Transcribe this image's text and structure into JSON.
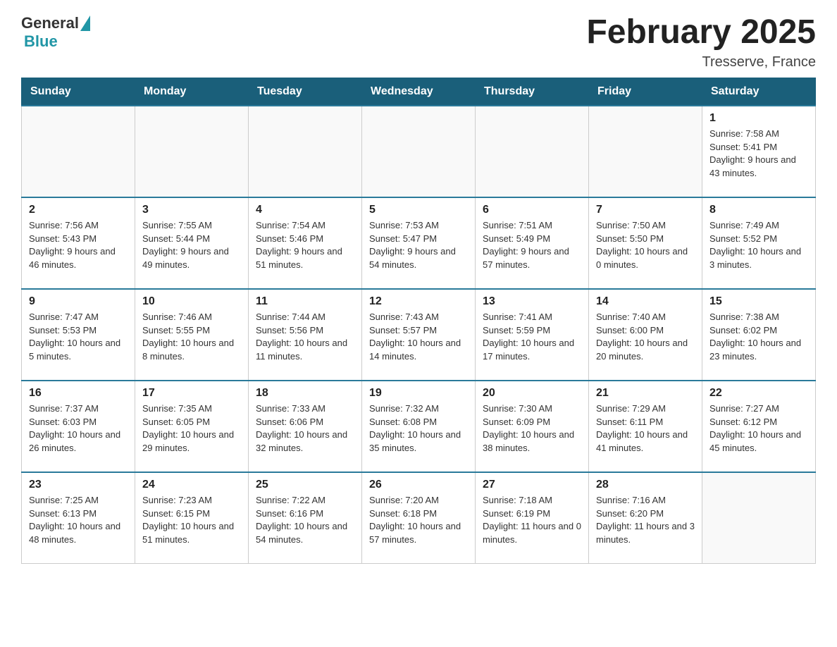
{
  "header": {
    "logo": {
      "general": "General",
      "blue": "Blue"
    },
    "title": "February 2025",
    "subtitle": "Tresserve, France"
  },
  "weekdays": [
    "Sunday",
    "Monday",
    "Tuesday",
    "Wednesday",
    "Thursday",
    "Friday",
    "Saturday"
  ],
  "weeks": [
    [
      {
        "day": "",
        "info": ""
      },
      {
        "day": "",
        "info": ""
      },
      {
        "day": "",
        "info": ""
      },
      {
        "day": "",
        "info": ""
      },
      {
        "day": "",
        "info": ""
      },
      {
        "day": "",
        "info": ""
      },
      {
        "day": "1",
        "info": "Sunrise: 7:58 AM\nSunset: 5:41 PM\nDaylight: 9 hours and 43 minutes."
      }
    ],
    [
      {
        "day": "2",
        "info": "Sunrise: 7:56 AM\nSunset: 5:43 PM\nDaylight: 9 hours and 46 minutes."
      },
      {
        "day": "3",
        "info": "Sunrise: 7:55 AM\nSunset: 5:44 PM\nDaylight: 9 hours and 49 minutes."
      },
      {
        "day": "4",
        "info": "Sunrise: 7:54 AM\nSunset: 5:46 PM\nDaylight: 9 hours and 51 minutes."
      },
      {
        "day": "5",
        "info": "Sunrise: 7:53 AM\nSunset: 5:47 PM\nDaylight: 9 hours and 54 minutes."
      },
      {
        "day": "6",
        "info": "Sunrise: 7:51 AM\nSunset: 5:49 PM\nDaylight: 9 hours and 57 minutes."
      },
      {
        "day": "7",
        "info": "Sunrise: 7:50 AM\nSunset: 5:50 PM\nDaylight: 10 hours and 0 minutes."
      },
      {
        "day": "8",
        "info": "Sunrise: 7:49 AM\nSunset: 5:52 PM\nDaylight: 10 hours and 3 minutes."
      }
    ],
    [
      {
        "day": "9",
        "info": "Sunrise: 7:47 AM\nSunset: 5:53 PM\nDaylight: 10 hours and 5 minutes."
      },
      {
        "day": "10",
        "info": "Sunrise: 7:46 AM\nSunset: 5:55 PM\nDaylight: 10 hours and 8 minutes."
      },
      {
        "day": "11",
        "info": "Sunrise: 7:44 AM\nSunset: 5:56 PM\nDaylight: 10 hours and 11 minutes."
      },
      {
        "day": "12",
        "info": "Sunrise: 7:43 AM\nSunset: 5:57 PM\nDaylight: 10 hours and 14 minutes."
      },
      {
        "day": "13",
        "info": "Sunrise: 7:41 AM\nSunset: 5:59 PM\nDaylight: 10 hours and 17 minutes."
      },
      {
        "day": "14",
        "info": "Sunrise: 7:40 AM\nSunset: 6:00 PM\nDaylight: 10 hours and 20 minutes."
      },
      {
        "day": "15",
        "info": "Sunrise: 7:38 AM\nSunset: 6:02 PM\nDaylight: 10 hours and 23 minutes."
      }
    ],
    [
      {
        "day": "16",
        "info": "Sunrise: 7:37 AM\nSunset: 6:03 PM\nDaylight: 10 hours and 26 minutes."
      },
      {
        "day": "17",
        "info": "Sunrise: 7:35 AM\nSunset: 6:05 PM\nDaylight: 10 hours and 29 minutes."
      },
      {
        "day": "18",
        "info": "Sunrise: 7:33 AM\nSunset: 6:06 PM\nDaylight: 10 hours and 32 minutes."
      },
      {
        "day": "19",
        "info": "Sunrise: 7:32 AM\nSunset: 6:08 PM\nDaylight: 10 hours and 35 minutes."
      },
      {
        "day": "20",
        "info": "Sunrise: 7:30 AM\nSunset: 6:09 PM\nDaylight: 10 hours and 38 minutes."
      },
      {
        "day": "21",
        "info": "Sunrise: 7:29 AM\nSunset: 6:11 PM\nDaylight: 10 hours and 41 minutes."
      },
      {
        "day": "22",
        "info": "Sunrise: 7:27 AM\nSunset: 6:12 PM\nDaylight: 10 hours and 45 minutes."
      }
    ],
    [
      {
        "day": "23",
        "info": "Sunrise: 7:25 AM\nSunset: 6:13 PM\nDaylight: 10 hours and 48 minutes."
      },
      {
        "day": "24",
        "info": "Sunrise: 7:23 AM\nSunset: 6:15 PM\nDaylight: 10 hours and 51 minutes."
      },
      {
        "day": "25",
        "info": "Sunrise: 7:22 AM\nSunset: 6:16 PM\nDaylight: 10 hours and 54 minutes."
      },
      {
        "day": "26",
        "info": "Sunrise: 7:20 AM\nSunset: 6:18 PM\nDaylight: 10 hours and 57 minutes."
      },
      {
        "day": "27",
        "info": "Sunrise: 7:18 AM\nSunset: 6:19 PM\nDaylight: 11 hours and 0 minutes."
      },
      {
        "day": "28",
        "info": "Sunrise: 7:16 AM\nSunset: 6:20 PM\nDaylight: 11 hours and 3 minutes."
      },
      {
        "day": "",
        "info": ""
      }
    ]
  ]
}
